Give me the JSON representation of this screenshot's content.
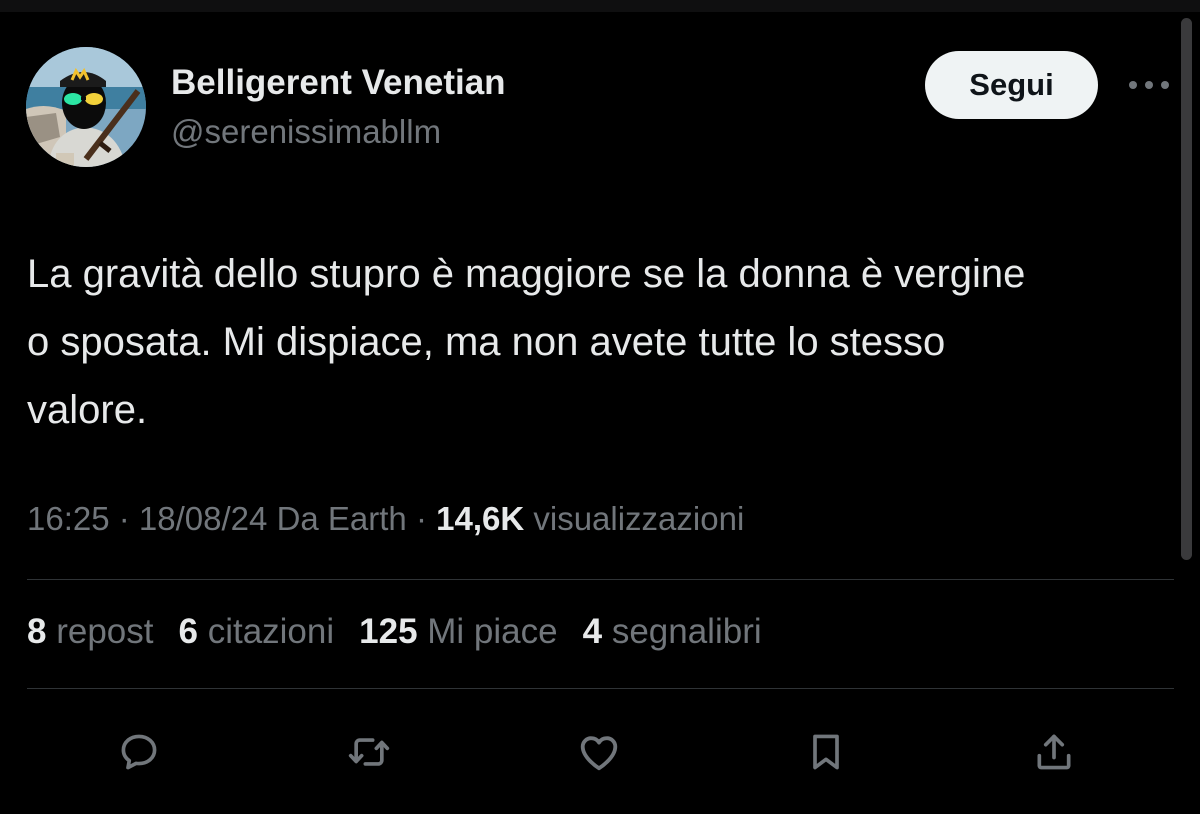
{
  "colors": {
    "background": "#000000",
    "primary_text": "#e7e9ea",
    "secondary_text": "#71767b",
    "divider": "#2f3336",
    "follow_button_bg": "#eff3f4",
    "follow_button_text": "#0f1419"
  },
  "author": {
    "display_name": "Belligerent Venetian",
    "handle": "@serenissimabllm"
  },
  "header": {
    "follow_label": "Segui",
    "more_icon": "more-dots-icon"
  },
  "tweet": {
    "text_lines": [
      "La gravità dello stupro è maggiore se la donna è vergine",
      "o sposata. Mi dispiace, ma non avete tutte lo stesso",
      "valore."
    ]
  },
  "meta": {
    "time": "16:25",
    "separator": " · ",
    "date": "18/08/24",
    "source": "Da Earth",
    "views_count": "14,6K",
    "views_label": "visualizzazioni"
  },
  "stats": [
    {
      "count": "8",
      "label": "repost"
    },
    {
      "count": "6",
      "label": "citazioni"
    },
    {
      "count": "125",
      "label": "Mi piace"
    },
    {
      "count": "4",
      "label": "segnalibri"
    }
  ],
  "actions": [
    {
      "icon": "reply-icon"
    },
    {
      "icon": "repost-icon"
    },
    {
      "icon": "like-icon"
    },
    {
      "icon": "bookmark-icon"
    },
    {
      "icon": "share-icon"
    }
  ]
}
